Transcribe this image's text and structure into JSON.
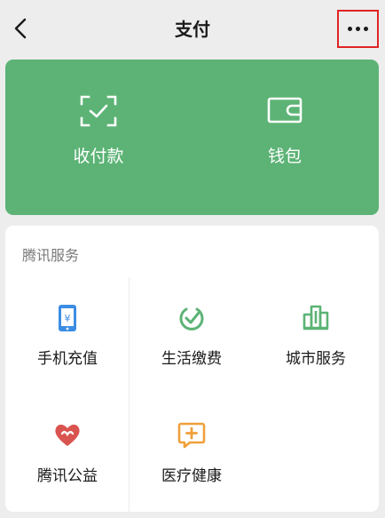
{
  "nav": {
    "title": "支付",
    "back_icon": "chevron-left-icon",
    "more_icon": "more-dots-icon"
  },
  "top_card": {
    "color": "#5cb375",
    "items": [
      {
        "label": "收付款",
        "icon": "scan-check-icon"
      },
      {
        "label": "钱包",
        "icon": "wallet-icon"
      }
    ]
  },
  "services": {
    "title": "腾讯服务",
    "items": [
      {
        "label": "手机充值",
        "icon": "phone-recharge-icon",
        "color": "#3b8de3"
      },
      {
        "label": "生活缴费",
        "icon": "utility-bill-icon",
        "color": "#5cb375"
      },
      {
        "label": "城市服务",
        "icon": "city-building-icon",
        "color": "#5cb375"
      },
      {
        "label": "腾讯公益",
        "icon": "charity-heart-icon",
        "color": "#d9534f"
      },
      {
        "label": "医疗健康",
        "icon": "medical-chat-icon",
        "color": "#f0a03a"
      }
    ]
  },
  "highlight_color": "#e02424"
}
